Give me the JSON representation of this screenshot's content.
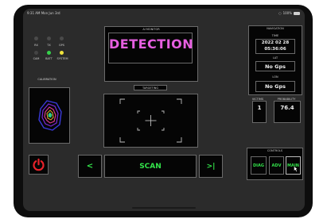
{
  "status_bar": {
    "time_date": "9:31 AM  Mon Jun 3rd",
    "battery": "100%"
  },
  "indicators": {
    "top": [
      {
        "label": "RX"
      },
      {
        "label": "TX"
      },
      {
        "label": "GPS"
      }
    ],
    "bottom": [
      {
        "label": "CAM",
        "color": "#444444"
      },
      {
        "label": "BATT",
        "color": "#35d24a"
      },
      {
        "label": "SYSTEM",
        "color": "#f0e43c"
      }
    ]
  },
  "calibration": {
    "title": "CALIBRATION"
  },
  "ai_monitor": {
    "title": "AI MONITOR",
    "status_text": "DETECTION",
    "status_color": "#e65fe0"
  },
  "targeting": {
    "button_label": "TARGETING"
  },
  "navigation": {
    "title": "NAVIGATION",
    "time_label": "TIME",
    "date": "2022 02 28",
    "time": "05:36:06",
    "lat_label": "LAT",
    "lat": "No Gps",
    "lon_label": "LON",
    "lon": "No Gps"
  },
  "stats": {
    "victims_label": "VICTIMS",
    "victims": "1",
    "probability_label": "PROBABILITY",
    "probability": "76.4"
  },
  "controls": {
    "title": "CONTROLS",
    "diag": "DIAG",
    "adv": "ADV",
    "main": "MAIN"
  },
  "bottom_bar": {
    "prev": "<",
    "scan": "SCAN",
    "next": ">|"
  },
  "colors": {
    "accent_green": "#33e34a",
    "power_red": "#e8222a",
    "bg_panel": "#2b2b2b"
  }
}
